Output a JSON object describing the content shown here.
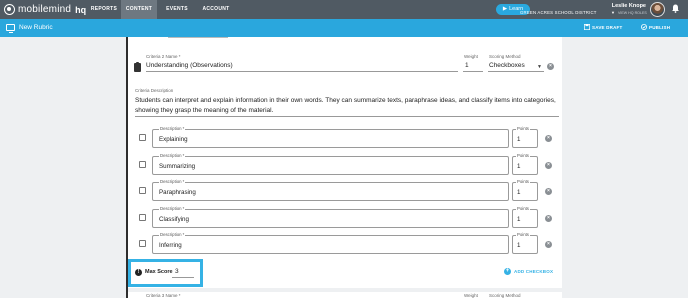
{
  "nav": {
    "logo_text": "mobilemind",
    "logo_hq": "hq",
    "tabs": [
      "REPORTS",
      "CONTENT",
      "EVENTS",
      "ACCOUNT"
    ],
    "active_tab": "CONTENT",
    "learn_label": "Learn",
    "user_name": "Leslie Knope",
    "district": "GREEN ACRES SCHOOL DISTRICT",
    "user_sub": "VIEW HQ ROLES"
  },
  "subbar": {
    "title": "New Rubric",
    "save_label": "SAVE DRAFT",
    "publish_label": "PUBLISH"
  },
  "criteria2": {
    "name_label": "Criteria 2 Name *",
    "name_value": "Understanding  (Observations)",
    "weight_label": "Weight",
    "weight_value": "1",
    "method_label": "Scoring Method",
    "method_value": "Checkboxes",
    "desc_label": "Criteria Description",
    "desc_value": "Students can interpret and explain information in their own words. They can summarize texts, paraphrase ideas, and classify items into categories, showing they grasp the meaning of the material.",
    "rows": [
      {
        "desc_label": "Description *",
        "desc": "Explaining",
        "points_label": "Points",
        "points": "1"
      },
      {
        "desc_label": "Description *",
        "desc": "Summarizing",
        "points_label": "Points",
        "points": "1"
      },
      {
        "desc_label": "Description *",
        "desc": "Paraphrasing",
        "points_label": "Points",
        "points": "1"
      },
      {
        "desc_label": "Description *",
        "desc": "Classifying",
        "points_label": "Points",
        "points": "1"
      },
      {
        "desc_label": "Description *",
        "desc": "Inferring",
        "points_label": "Points",
        "points": "1"
      }
    ],
    "max_score_label": "Max Score",
    "max_score_value": "3",
    "add_checkbox_label": "ADD CHECKBOX"
  },
  "criteria3": {
    "name_label": "Criteria 3 Name *",
    "weight_label": "Weight",
    "method_label": "Scoring Method"
  },
  "colors": {
    "nav_bg": "#505a63",
    "accent": "#2aa7dd",
    "highlight": "#35b2e5"
  }
}
